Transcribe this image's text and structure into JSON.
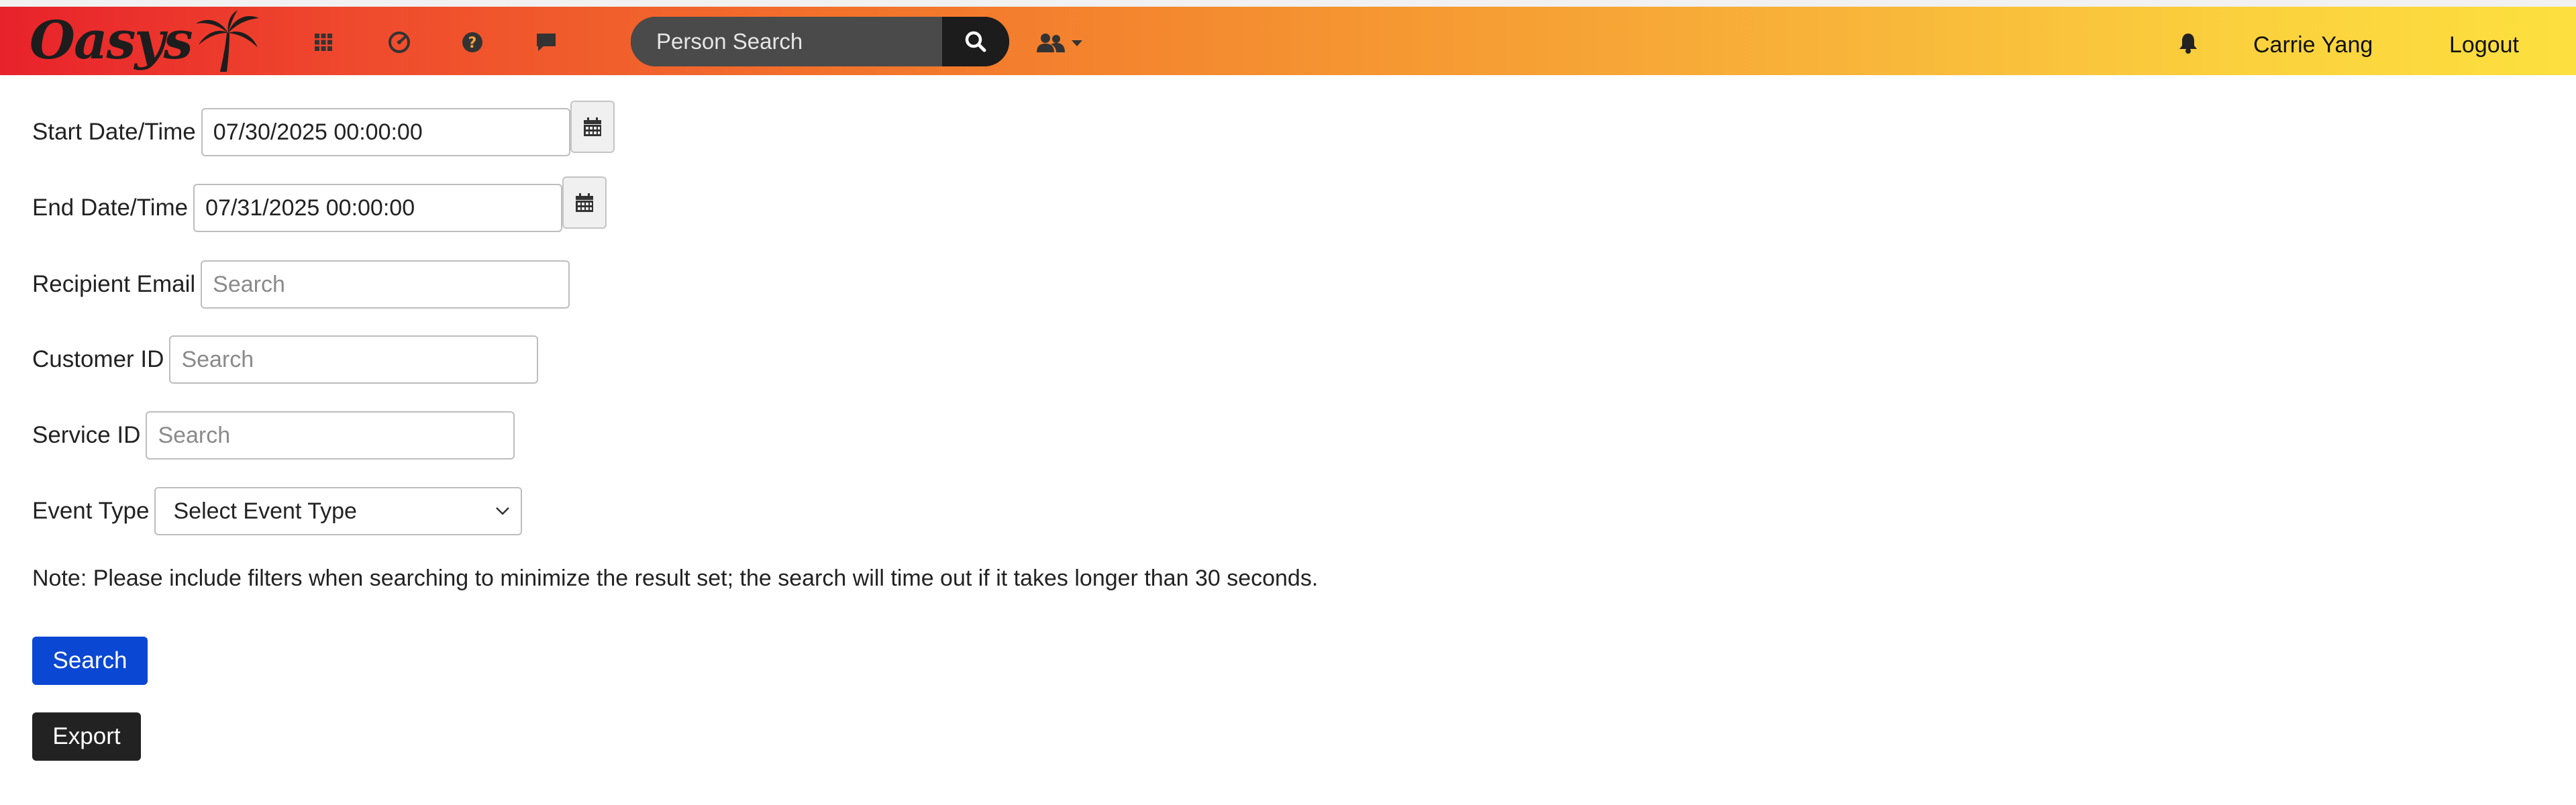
{
  "header": {
    "logo_text": "Oasys",
    "search_placeholder": "Person Search",
    "user_name": "Carrie Yang",
    "logout_label": "Logout",
    "icons": [
      "apps-grid-icon",
      "dashboard-gauge-icon",
      "help-icon",
      "chat-icon",
      "search-icon",
      "people-icon",
      "caret-down-icon",
      "bell-icon"
    ],
    "colors": {
      "gradient_start": "#e8222b",
      "gradient_end": "#fde03f"
    }
  },
  "form": {
    "start": {
      "label": "Start Date/Time",
      "value": "07/30/2025 00:00:00"
    },
    "end": {
      "label": "End Date/Time",
      "value": "07/31/2025 00:00:00"
    },
    "recipient": {
      "label": "Recipient Email",
      "placeholder": "Search"
    },
    "customer": {
      "label": "Customer ID",
      "placeholder": "Search"
    },
    "service": {
      "label": "Service ID",
      "placeholder": "Search"
    },
    "event_type": {
      "label": "Event Type",
      "selected": "Select Event Type"
    },
    "note": "Note: Please include filters when searching to minimize the result set; the search will time out if it takes longer than 30 seconds.",
    "search_label": "Search",
    "export_label": "Export",
    "colors": {
      "search_button": "#0a47d3",
      "export_button": "#222222"
    }
  }
}
